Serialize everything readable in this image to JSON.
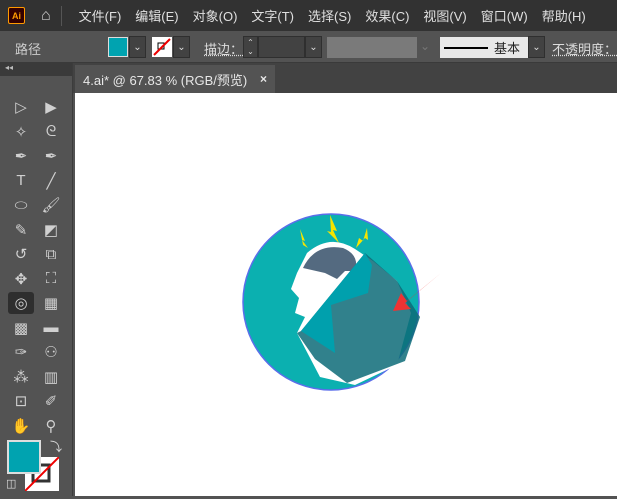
{
  "app": {
    "logo": "Ai"
  },
  "menu": [
    "文件(F)",
    "编辑(E)",
    "对象(O)",
    "文字(T)",
    "选择(S)",
    "效果(C)",
    "视图(V)",
    "窗口(W)",
    "帮助(H)"
  ],
  "control": {
    "object_type": "路径",
    "stroke_label": "描边：",
    "style_label": "基本",
    "opacity_label": "不透明度：",
    "fill_color": "#00a3b0"
  },
  "tab": {
    "title": "4.ai* @ 67.83 % (RGB/预览)",
    "close": "×"
  },
  "tools": [
    [
      "selection",
      "direct-selection"
    ],
    [
      "magic-wand",
      "lasso"
    ],
    [
      "pen",
      "curvature"
    ],
    [
      "type",
      "line"
    ],
    [
      "ellipse",
      "paintbrush"
    ],
    [
      "shaper",
      "eraser"
    ],
    [
      "rotate",
      "scale"
    ],
    [
      "puppet-warp",
      "free-transform"
    ],
    [
      "shape-builder",
      "perspective-grid"
    ],
    [
      "mesh",
      "gradient"
    ],
    [
      "eyedropper",
      "blend"
    ],
    [
      "symbol-sprayer",
      "column-graph"
    ],
    [
      "artboard",
      "slice"
    ],
    [
      "hand",
      "zoom"
    ]
  ],
  "colors": {
    "fill": "#00a3b0",
    "stroke": "none",
    "circle": "#0bb0b0",
    "outline": "#5a6eea",
    "brain": "#546a80",
    "arrow": "#ee3333",
    "bolt": "#f5e400"
  }
}
